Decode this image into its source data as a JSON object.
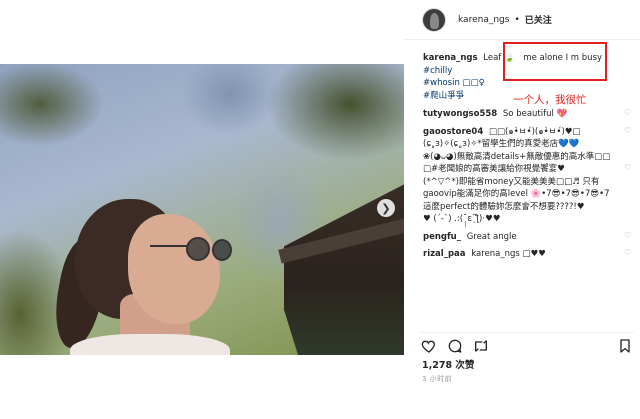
{
  "post": {
    "username": "karena_ngs",
    "separator": "•",
    "follow_status": "已关注"
  },
  "caption": {
    "user": "karena_ngs",
    "text": "Leaf 🍃",
    "highlight": "me alone I m busy",
    "tags": [
      "#chilly",
      "#whosin □□♀",
      "#爬山爭爭"
    ]
  },
  "annotation": {
    "text": "一个人，我很忙"
  },
  "comments": [
    {
      "user": "tutywongso558",
      "text": "So beautiful 💖"
    },
    {
      "user": "gaoostore04",
      "text": "□□(๑•̀ㅂ•́)(๑•̀ㅂ•́)♥□ (ɕ˳ɜ)✧(ɕ˳ɜ)✧*留學生們的真愛老店💙💙"
    },
    {
      "user": "",
      "text": "❀(◕ᴗ◕)無敵高清details+無敵優惠的高水準□□"
    },
    {
      "user": "",
      "text": "□#老闆娘的高審美讓給你視覺饗宴♥"
    },
    {
      "user": "",
      "text": "(*^▽^*)即能省money又能美美美□□♬ 只有gaoovip能滿足你的高level 🌸•7😎•7😎•7😎•7這麼perfect的體驗妳怎麼會不想要????!♥"
    },
    {
      "user": "",
      "text": "♥ (´-`) .:(˘̩̩̩ε˘̩ƪ)·♥♥"
    },
    {
      "user": "pengfu_",
      "text": "Great angle"
    },
    {
      "user": "rizal_paa",
      "text": "karena_ngs □♥♥"
    }
  ],
  "stats": {
    "likes": "1,278 次赞",
    "time": "3 小时前"
  }
}
